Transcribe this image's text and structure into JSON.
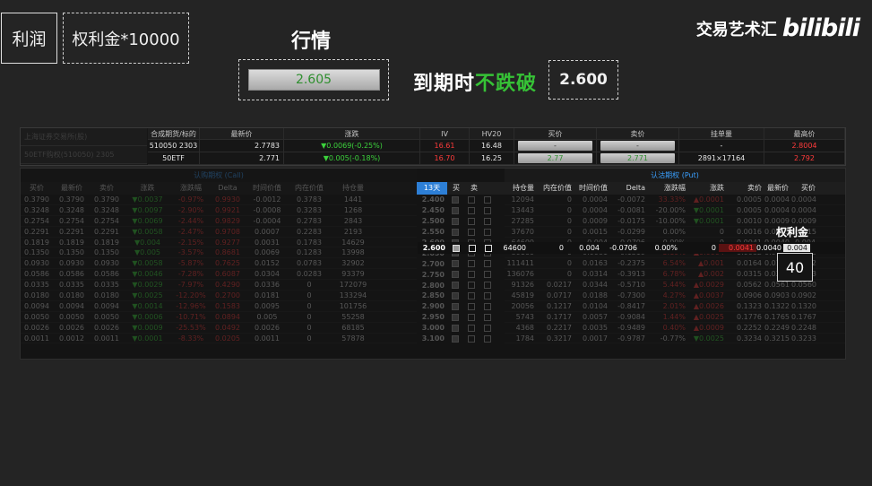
{
  "overlay": {
    "profit_label": "利润",
    "formula_label": "权利金*10000",
    "market_title": "行情",
    "market_price": "2.605",
    "expiry_prefix": "到期时",
    "expiry_highlight": "不跌破",
    "strike_value": "2.600",
    "brand_cn": "交易艺术汇",
    "brand_logo": "bilibili",
    "premium_label": "权利金",
    "premium_value": "40"
  },
  "quote_header": {
    "left_dim": [
      "上海证券交易所(股)",
      "50ETF购权(510050)  2305"
    ],
    "columns": [
      "合成期货/标的",
      "最新价",
      "涨跌",
      "IV",
      "HV20",
      "买价",
      "卖价",
      "挂单量",
      "最高价"
    ],
    "rows": [
      {
        "name": "510050 2303",
        "last": "2.7783",
        "change": "▼0.0069(-0.25%)",
        "iv": "16.61",
        "hv": "16.48",
        "bid": "-",
        "ask": "-",
        "depth": "-",
        "high": "2.8004"
      },
      {
        "name": "50ETF",
        "last": "2.771",
        "change": "▼0.005(-0.18%)",
        "iv": "16.70",
        "hv": "16.25",
        "bid": "2.77",
        "ask": "2.771",
        "depth": "2891×17164",
        "high": "2.792"
      }
    ]
  },
  "chain": {
    "call_title": "认购期权 (Call)",
    "put_title": "认沽期权 (Put)",
    "call_columns": [
      "买价",
      "最新价",
      "卖价",
      "涨跌",
      "涨跌幅",
      "Delta",
      "时间价值",
      "内在价值",
      "持仓量",
      "买",
      "卖"
    ],
    "strike_header": "13天",
    "put_columns": [
      "持仓量",
      "内在价值",
      "时间价值",
      "Delta",
      "涨跌幅",
      "涨跌",
      "卖价",
      "最新价",
      "买价"
    ],
    "call_rows": [
      [
        "0.3790",
        "0.3790",
        "▼0.0037",
        "-0.97%",
        "0.9930",
        "-0.0012",
        "0.3783",
        "1441"
      ],
      [
        "0.3248",
        "0.3248",
        "▼0.0097",
        "-2.90%",
        "0.9921",
        "-0.0008",
        "0.3283",
        "1268"
      ],
      [
        "0.2754",
        "0.2754",
        "▼0.0069",
        "-2.44%",
        "0.9829",
        "-0.0004",
        "0.2783",
        "2843"
      ],
      [
        "0.2291",
        "0.2291",
        "▼0.0058",
        "-2.47%",
        "0.9708",
        "0.0007",
        "0.2283",
        "2193"
      ],
      [
        "0.1819",
        "0.1819",
        "▼0.004",
        "-2.15%",
        "0.9277",
        "0.0031",
        "0.1783",
        "14629"
      ],
      [
        "0.1350",
        "0.1350",
        "▼0.005",
        "-3.57%",
        "0.8681",
        "0.0069",
        "0.1283",
        "13998"
      ],
      [
        "0.0930",
        "0.0930",
        "▼0.0058",
        "-5.87%",
        "0.7625",
        "0.0152",
        "0.0783",
        "32902"
      ],
      [
        "0.0586",
        "0.0586",
        "▼0.0046",
        "-7.28%",
        "0.6087",
        "0.0304",
        "0.0283",
        "93379"
      ],
      [
        "0.0335",
        "0.0335",
        "▼0.0029",
        "-7.97%",
        "0.4290",
        "0.0336",
        "0",
        "172079"
      ],
      [
        "0.0180",
        "0.0180",
        "▼0.0025",
        "-12.20%",
        "0.2700",
        "0.0181",
        "0",
        "133294"
      ],
      [
        "0.0094",
        "0.0094",
        "▼0.0014",
        "-12.96%",
        "0.1583",
        "0.0095",
        "0",
        "101756"
      ],
      [
        "0.0050",
        "0.0050",
        "▼0.0006",
        "-10.71%",
        "0.0894",
        "0.005",
        "0",
        "55258"
      ],
      [
        "0.0026",
        "0.0026",
        "▼0.0009",
        "-25.53%",
        "0.0492",
        "0.0026",
        "0",
        "68185"
      ],
      [
        "0.0011",
        "0.0012",
        "▼0.0001",
        "-8.33%",
        "0.0205",
        "0.0011",
        "0",
        "57878"
      ]
    ],
    "strikes": [
      "2.400",
      "2.450",
      "2.500",
      "2.550",
      "2.600",
      "2.650",
      "2.700",
      "2.750",
      "2.800",
      "2.850",
      "2.900",
      "2.950",
      "3.000",
      "3.100"
    ],
    "put_rows": [
      [
        "12094",
        "0",
        "0.0004",
        "-0.0072",
        "33.33%",
        "▲0.0001",
        "0.0005",
        "0.0004",
        "0.0004"
      ],
      [
        "13443",
        "0",
        "0.0004",
        "-0.0081",
        "-20.00%",
        "▼0.0001",
        "0.0005",
        "0.0004",
        "0.0004"
      ],
      [
        "27285",
        "0",
        "0.0009",
        "-0.0175",
        "-10.00%",
        "▼0.0001",
        "0.0010",
        "0.0009",
        "0.0009"
      ],
      [
        "37670",
        "0",
        "0.0015",
        "-0.0299",
        "0.00%",
        "0",
        "0.0016",
        "0.0015",
        "0.0015"
      ],
      [
        "64600",
        "0",
        "0.004",
        "-0.0706",
        "0.00%",
        "0",
        "0.0041",
        "0.0040",
        "0.004"
      ],
      [
        "80160",
        "0",
        "0.0081",
        "-0.1319",
        "5.19%",
        "▲0.0004",
        "0.0082",
        "0.0081",
        "0.0080"
      ],
      [
        "111411",
        "0",
        "0.0163",
        "-0.2375",
        "6.54%",
        "▲0.001",
        "0.0164",
        "0.0163",
        "0.0162"
      ],
      [
        "136076",
        "0",
        "0.0314",
        "-0.3913",
        "6.78%",
        "▲0.002",
        "0.0315",
        "0.0314",
        "0.0313"
      ],
      [
        "91326",
        "0.0217",
        "0.0344",
        "-0.5710",
        "5.44%",
        "▲0.0029",
        "0.0562",
        "0.0561",
        "0.0560"
      ],
      [
        "45819",
        "0.0717",
        "0.0188",
        "-0.7300",
        "4.27%",
        "▲0.0037",
        "0.0906",
        "0.0903",
        "0.0902"
      ],
      [
        "20056",
        "0.1217",
        "0.0104",
        "-0.8417",
        "2.01%",
        "▲0.0026",
        "0.1323",
        "0.1322",
        "0.1320"
      ],
      [
        "5743",
        "0.1717",
        "0.0057",
        "-0.9084",
        "1.44%",
        "▲0.0025",
        "0.1776",
        "0.1765",
        "0.1767"
      ],
      [
        "4368",
        "0.2217",
        "0.0035",
        "-0.9489",
        "0.40%",
        "▲0.0009",
        "0.2252",
        "0.2249",
        "0.2248"
      ],
      [
        "1784",
        "0.3217",
        "0.0017",
        "-0.9787",
        "-0.77%",
        "▼0.0025",
        "0.3234",
        "0.3215",
        "0.3233"
      ]
    ]
  },
  "colors": {
    "up": "#ff3b3b",
    "down": "#3cd23c",
    "accent": "#2d7fd6",
    "background": "#242424"
  }
}
